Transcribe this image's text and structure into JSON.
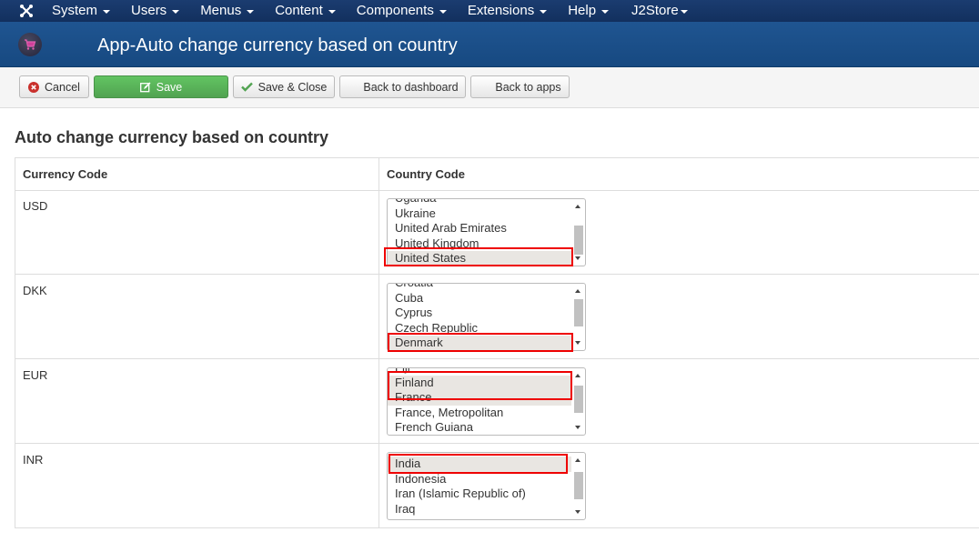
{
  "nav": {
    "items": [
      "System",
      "Users",
      "Menus",
      "Content",
      "Components",
      "Extensions",
      "Help"
    ],
    "j2store": "J2Store"
  },
  "header": {
    "title": "App-Auto change currency based on country"
  },
  "toolbar": {
    "cancel": "Cancel",
    "save": "Save",
    "save_close": "Save & Close",
    "back_dashboard": "Back to dashboard",
    "back_apps": "Back to apps"
  },
  "section": {
    "title": "Auto change currency based on country"
  },
  "table": {
    "headers": {
      "currency": "Currency Code",
      "country": "Country Code"
    },
    "rows": [
      {
        "code": "USD",
        "options": [
          "Uganda",
          "Ukraine",
          "United Arab Emirates",
          "United Kingdom",
          "United States"
        ],
        "selected": [
          "United States"
        ]
      },
      {
        "code": "DKK",
        "options": [
          "Croatia",
          "Cuba",
          "Cyprus",
          "Czech Republic",
          "Denmark"
        ],
        "selected": [
          "Denmark"
        ]
      },
      {
        "code": "EUR",
        "options": [
          "Fiji",
          "Finland",
          "France",
          "France, Metropolitan",
          "French Guiana"
        ],
        "selected": [
          "Finland",
          "France"
        ]
      },
      {
        "code": "INR",
        "options": [
          "India",
          "Indonesia",
          "Iran (Islamic Republic of)",
          "Iraq"
        ],
        "selected": [
          "India"
        ]
      }
    ]
  },
  "colors": {
    "highlight": "#e00000",
    "save_button": "#5bb75b",
    "header": "#1f5591",
    "navbar": "#1b3c70"
  }
}
